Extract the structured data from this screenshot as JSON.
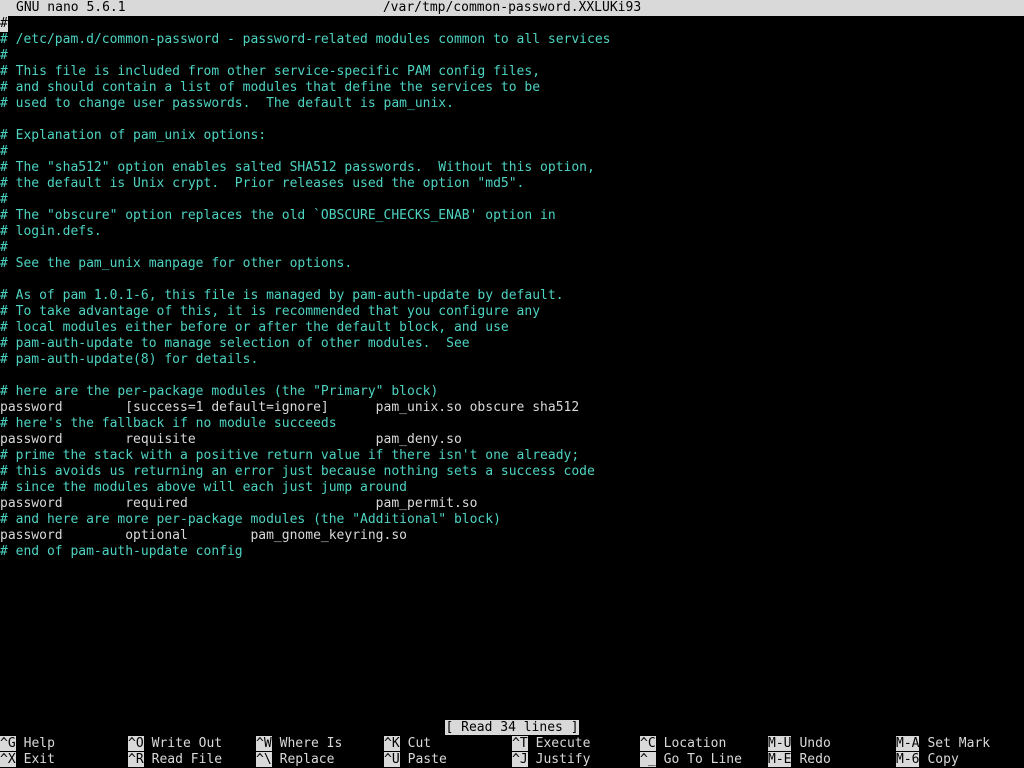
{
  "titlebar": {
    "app": "GNU nano 5.6.1",
    "file": "/var/tmp/common-password.XXLUKi93"
  },
  "lines": [
    {
      "t": "#",
      "k": "comment"
    },
    {
      "t": "# /etc/pam.d/common-password - password-related modules common to all services",
      "k": "comment"
    },
    {
      "t": "#",
      "k": "comment"
    },
    {
      "t": "# This file is included from other service-specific PAM config files,",
      "k": "comment"
    },
    {
      "t": "# and should contain a list of modules that define the services to be",
      "k": "comment"
    },
    {
      "t": "# used to change user passwords.  The default is pam_unix.",
      "k": "comment"
    },
    {
      "t": "",
      "k": "comment"
    },
    {
      "t": "# Explanation of pam_unix options:",
      "k": "comment"
    },
    {
      "t": "#",
      "k": "comment"
    },
    {
      "t": "# The \"sha512\" option enables salted SHA512 passwords.  Without this option,",
      "k": "comment"
    },
    {
      "t": "# the default is Unix crypt.  Prior releases used the option \"md5\".",
      "k": "comment"
    },
    {
      "t": "#",
      "k": "comment"
    },
    {
      "t": "# The \"obscure\" option replaces the old `OBSCURE_CHECKS_ENAB' option in",
      "k": "comment"
    },
    {
      "t": "# login.defs.",
      "k": "comment"
    },
    {
      "t": "#",
      "k": "comment"
    },
    {
      "t": "# See the pam_unix manpage for other options.",
      "k": "comment"
    },
    {
      "t": "",
      "k": "comment"
    },
    {
      "t": "# As of pam 1.0.1-6, this file is managed by pam-auth-update by default.",
      "k": "comment"
    },
    {
      "t": "# To take advantage of this, it is recommended that you configure any",
      "k": "comment"
    },
    {
      "t": "# local modules either before or after the default block, and use",
      "k": "comment"
    },
    {
      "t": "# pam-auth-update to manage selection of other modules.  See",
      "k": "comment"
    },
    {
      "t": "# pam-auth-update(8) for details.",
      "k": "comment"
    },
    {
      "t": "",
      "k": "comment"
    },
    {
      "t": "# here are the per-package modules (the \"Primary\" block)",
      "k": "comment"
    },
    {
      "t": "password        [success=1 default=ignore]      pam_unix.so obscure sha512",
      "k": "code"
    },
    {
      "t": "# here's the fallback if no module succeeds",
      "k": "comment"
    },
    {
      "t": "password        requisite                       pam_deny.so",
      "k": "code"
    },
    {
      "t": "# prime the stack with a positive return value if there isn't one already;",
      "k": "comment"
    },
    {
      "t": "# this avoids us returning an error just because nothing sets a success code",
      "k": "comment"
    },
    {
      "t": "# since the modules above will each just jump around",
      "k": "comment"
    },
    {
      "t": "password        required                        pam_permit.so",
      "k": "code"
    },
    {
      "t": "# and here are more per-package modules (the \"Additional\" block)",
      "k": "comment"
    },
    {
      "t": "password        optional        pam_gnome_keyring.so",
      "k": "code"
    },
    {
      "t": "# end of pam-auth-update config",
      "k": "comment"
    }
  ],
  "status": "[ Read 34 lines ]",
  "shortcuts": [
    {
      "key": "^G",
      "label": "Help"
    },
    {
      "key": "^X",
      "label": "Exit"
    },
    {
      "key": "^O",
      "label": "Write Out"
    },
    {
      "key": "^R",
      "label": "Read File"
    },
    {
      "key": "^W",
      "label": "Where Is"
    },
    {
      "key": "^\\",
      "label": "Replace"
    },
    {
      "key": "^K",
      "label": "Cut"
    },
    {
      "key": "^U",
      "label": "Paste"
    },
    {
      "key": "^T",
      "label": "Execute"
    },
    {
      "key": "^J",
      "label": "Justify"
    },
    {
      "key": "^C",
      "label": "Location"
    },
    {
      "key": "^_",
      "label": "Go To Line"
    },
    {
      "key": "M-U",
      "label": "Undo"
    },
    {
      "key": "M-E",
      "label": "Redo"
    },
    {
      "key": "M-A",
      "label": "Set Mark"
    },
    {
      "key": "M-6",
      "label": "Copy"
    }
  ]
}
